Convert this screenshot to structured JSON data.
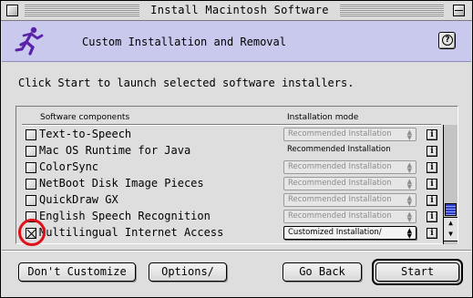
{
  "window": {
    "title": "Install Macintosh Software"
  },
  "header": {
    "title": "Custom Installation and Removal",
    "icon": "running-man-icon",
    "help_label": "?"
  },
  "instructions": "Click Start to launch selected software installers.",
  "list": {
    "columns": {
      "components": "Software components",
      "mode": "Installation mode"
    },
    "items": [
      {
        "name": "Text-to-Speech",
        "checked": false,
        "mode": "Recommended Installation",
        "mode_state": "disabled",
        "info": "i"
      },
      {
        "name": "Mac OS Runtime for Java",
        "checked": false,
        "mode": "Recommended Installation",
        "mode_state": "plain",
        "info": "i"
      },
      {
        "name": "ColorSync",
        "checked": false,
        "mode": "Recommended Installation",
        "mode_state": "disabled",
        "info": "i"
      },
      {
        "name": "NetBoot Disk Image Pieces",
        "checked": false,
        "mode": "Recommended Installation",
        "mode_state": "disabled",
        "info": "i"
      },
      {
        "name": "QuickDraw GX",
        "checked": false,
        "mode": "Recommended Installation",
        "mode_state": "disabled",
        "info": "i"
      },
      {
        "name": "English Speech Recognition",
        "checked": false,
        "mode": "Recommended Installation",
        "mode_state": "disabled",
        "info": "i"
      },
      {
        "name": "Multilingual Internet Access",
        "checked": true,
        "mode": "Customized Installation/",
        "mode_state": "active",
        "info": "i"
      }
    ],
    "scroll_up_glyph": "▲",
    "scroll_down_glyph": "▼"
  },
  "buttons": {
    "dont_customize": "Don't Customize",
    "options": "Options/",
    "go_back": "Go Back",
    "start": "Start"
  },
  "colors": {
    "header_bg": "#c9c9ee",
    "highlight": "#e0101a",
    "scroll_thumb": "#2c3cc8"
  }
}
